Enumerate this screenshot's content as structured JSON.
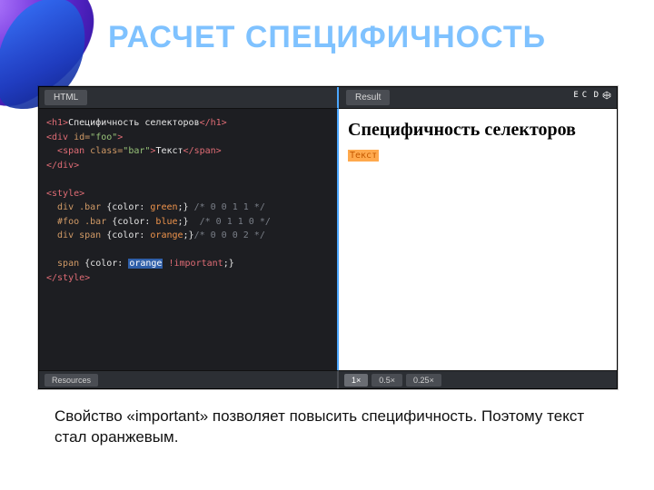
{
  "title": "РАСЧЕТ СПЕЦИФИЧНОСТЬ",
  "pen": {
    "tabs": {
      "html": "HTML",
      "result": "Result"
    },
    "brand_prefix": "E",
    "brand": "C  D",
    "code": {
      "l1_open": "<h1>",
      "l1_text": "Специфичность селекторов",
      "l1_close": "</h1>",
      "l2_open": "<div ",
      "l2_attr": "id=",
      "l2_val": "\"foo\"",
      "l2_close": ">",
      "l3_indent": "  ",
      "l3_open": "<span ",
      "l3_attr": "class=",
      "l3_val": "\"bar\"",
      "l3_close": ">",
      "l3_text": "Текст",
      "l3_end": "</span>",
      "l4": "</div>",
      "l6": "<style>",
      "l7_sel": "  div .bar ",
      "l7_body": "{color: ",
      "l7_val": "green",
      "l7_end": ";} ",
      "l7_c": "/* 0 0 1 1 */",
      "l8_sel": "  #foo .bar ",
      "l8_body": "{color: ",
      "l8_val": "blue",
      "l8_end": ";}  ",
      "l8_c": "/* 0 1 1 0 */",
      "l9_sel": "  div span ",
      "l9_body": "{color: ",
      "l9_val": "orange",
      "l9_end": ";}",
      "l9_c": "/* 0 0 0 2 */",
      "l11_sel": "  span ",
      "l11_body": "{color: ",
      "l11_val": "orange",
      "l11_imp": " !important",
      "l11_end": ";}",
      "l12": "</style>"
    },
    "result": {
      "heading": "Специфичность селекторов",
      "text": "Текст"
    },
    "footer": {
      "resources": "Resources",
      "zoom": [
        "1×",
        "0.5×",
        "0.25×"
      ]
    }
  },
  "caption": "Свойство «important» позволяет повысить специфичность. Поэтому текст стал оранжевым."
}
